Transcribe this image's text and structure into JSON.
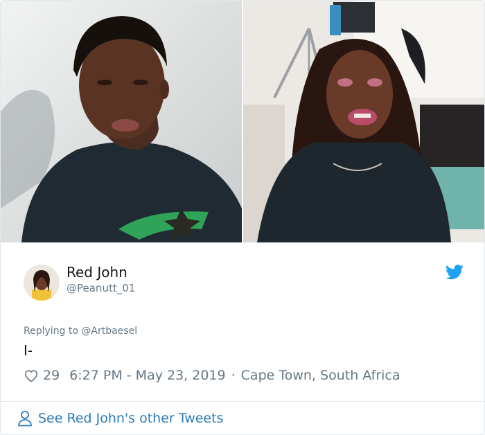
{
  "tweet": {
    "author": {
      "display_name": "Red John",
      "handle": "@Peanutt_01"
    },
    "replying_to_prefix": "Replying to",
    "replying_to_handle": "@Artbaesel",
    "text": "I-",
    "likes": "29",
    "timestamp": "6:27 PM - May 23, 2019",
    "separator": "·",
    "location": "Cape Town, South Africa"
  },
  "footer": {
    "link_label": "See Red John's other Tweets"
  },
  "colors": {
    "twitter_blue": "#1da1f2",
    "link_blue": "#2b7bb9",
    "secondary_text": "#657786",
    "primary_text": "#14171a"
  },
  "icons": {
    "brand": "twitter-bird-icon",
    "like": "heart-icon",
    "profile": "person-icon"
  }
}
